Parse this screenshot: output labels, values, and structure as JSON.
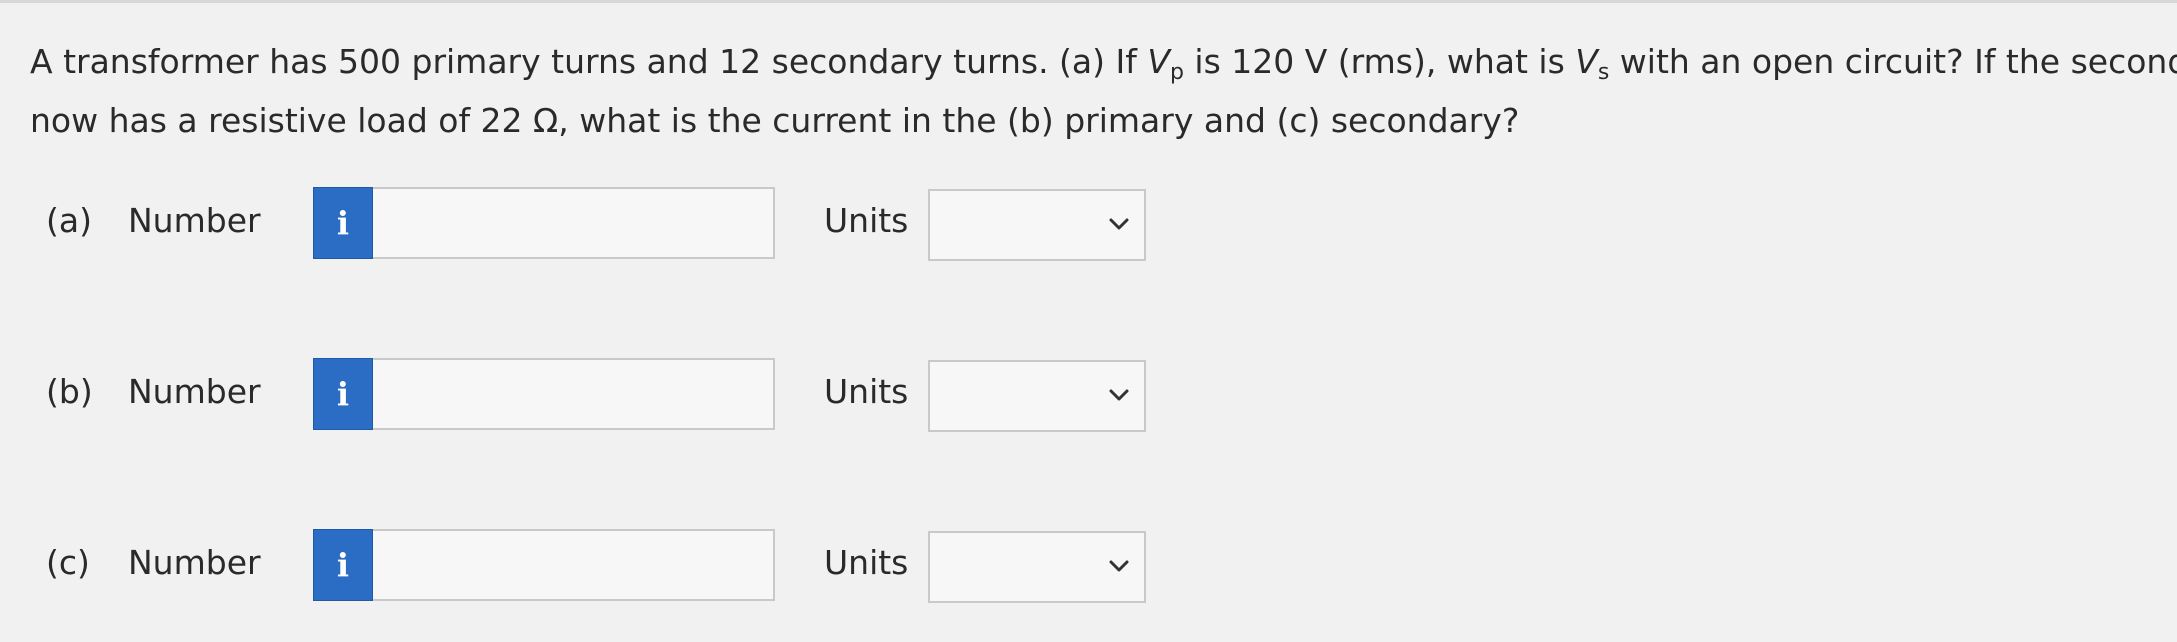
{
  "question": {
    "line1_a": "A transformer has 500 primary turns and 12 secondary turns. (a) If ",
    "vp_symbol": "V",
    "vp_sub": "p",
    "line1_b": " is 120 V (rms), what is ",
    "vs_symbol": "V",
    "vs_sub": "s",
    "line1_c": " with an open circuit? If the secondary",
    "line2": "now has a resistive load of 22 Ω, what is the current in the (b) primary and (c) secondary?"
  },
  "parts": [
    {
      "label": "(a)",
      "number_label": "Number",
      "info_icon": "i",
      "number_value": "",
      "units_label": "Units",
      "units_value": ""
    },
    {
      "label": "(b)",
      "number_label": "Number",
      "info_icon": "i",
      "number_value": "",
      "units_label": "Units",
      "units_value": ""
    },
    {
      "label": "(c)",
      "number_label": "Number",
      "info_icon": "i",
      "number_value": "",
      "units_label": "Units",
      "units_value": ""
    }
  ],
  "colors": {
    "info_button": "#2b6cc4",
    "background": "#f1f1f1"
  }
}
